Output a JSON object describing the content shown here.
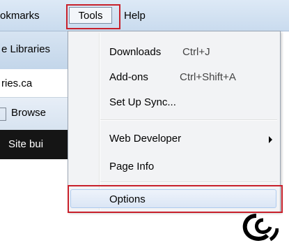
{
  "menubar": {
    "bookmarks_label": "okmarks",
    "tools_label": "Tools",
    "help_label": "Help"
  },
  "background": {
    "tab_text": "e Libraries",
    "url_text": "ries.ca",
    "bookmark_text": "Browse",
    "banner_text": "Site bui"
  },
  "tools_menu": {
    "items": [
      {
        "label": "Downloads",
        "shortcut": "Ctrl+J"
      },
      {
        "label": "Add-ons",
        "shortcut": "Ctrl+Shift+A"
      },
      {
        "label": "Set Up Sync..."
      },
      {
        "label": "Web Developer",
        "submenu": true
      },
      {
        "label": "Page Info"
      },
      {
        "label": "Options",
        "highlighted": true
      }
    ]
  },
  "colors": {
    "highlight_box": "#c8202b",
    "menubar_bg": "#c9dbee",
    "menu_bg": "#f2f3f5"
  }
}
